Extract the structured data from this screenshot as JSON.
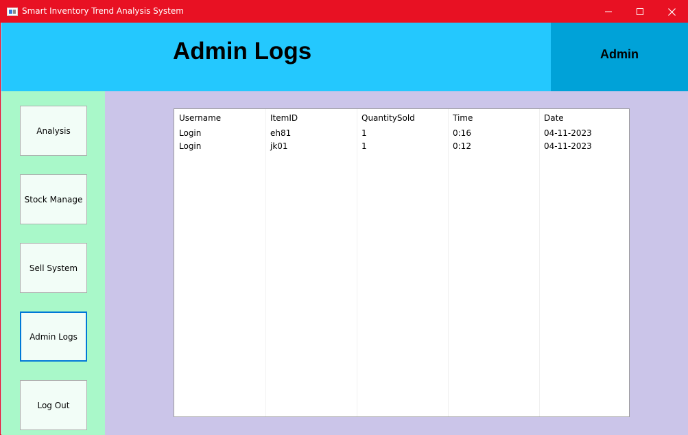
{
  "window": {
    "title": "Smart Inventory Trend Analysis System",
    "controls": {
      "minimize": "minimize-icon",
      "maximize": "maximize-icon",
      "close": "close-icon"
    }
  },
  "header": {
    "title": "Admin Logs",
    "user": "Admin"
  },
  "sidebar": {
    "items": [
      {
        "label": "Analysis",
        "active": false
      },
      {
        "label": "Stock Manage",
        "active": false
      },
      {
        "label": "Sell System",
        "active": false
      },
      {
        "label": "Admin Logs",
        "active": true
      },
      {
        "label": "Log Out",
        "active": false
      }
    ]
  },
  "table": {
    "columns": [
      "Username",
      "ItemID",
      "QuantitySold",
      "Time",
      "Date"
    ],
    "rows": [
      [
        "Login",
        "eh81",
        "1",
        "0:16",
        "04-11-2023"
      ],
      [
        "Login",
        "jk01",
        "1",
        "0:12",
        "04-11-2023"
      ]
    ]
  },
  "colors": {
    "titlebar": "#e81123",
    "header": "#24c8fe",
    "userbox": "#00a2d8",
    "sidebar": "#a9f8c9",
    "main": "#cbc5e9",
    "active_border": "#0078d7"
  }
}
